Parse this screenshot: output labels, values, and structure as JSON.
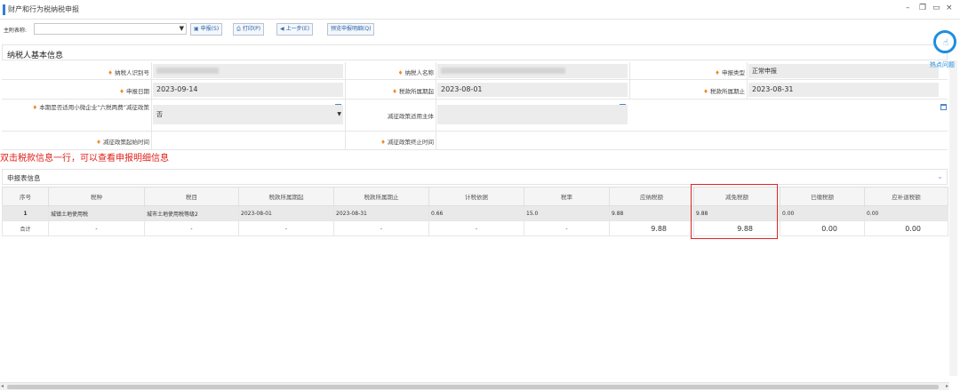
{
  "window": {
    "title": "财产和行为税纳税申报",
    "controls": {
      "minimize": "–",
      "restore": "❐",
      "maximize": "▭",
      "close": "×"
    }
  },
  "toolbar": {
    "main_table_label": "主附表称:",
    "main_table_value": "",
    "declare_label": "申报(S)",
    "print_label": "打印(P)",
    "prev_label": "上一步(E)",
    "preview_label": "预览申报明细(Q)"
  },
  "basic_info": {
    "section_title": "纳税人基本信息",
    "taxpayer_id_label": "纳税人识别号",
    "taxpayer_name_label": "纳税人名称",
    "declare_type_label": "申报类型",
    "declare_type_value": "正常申报",
    "declare_date_label": "申报日期",
    "declare_date_value": "2023-09-14",
    "period_start_label": "税款所属期起",
    "period_start_value": "2023-08-01",
    "period_end_label": "税款所属期止",
    "period_end_value": "2023-08-31",
    "small_biz_label": "本期是否适用小微企业“六税两费”减征政策",
    "small_biz_value": "否",
    "reduction_subject_label": "减征政策适用主体",
    "reduction_start_label": "减征政策起始时间",
    "reduction_end_label": "减征政策终止时间"
  },
  "hint_text": "双击税款信息一行，可以查看申报明细信息",
  "declare_table": {
    "section_title": "申报表信息",
    "columns": [
      "序号",
      "税种",
      "税目",
      "税款所属期起",
      "税款所属期止",
      "计税依据",
      "税率",
      "应纳税额",
      "减免税额",
      "已缴税额",
      "应补退税额"
    ],
    "rows": [
      [
        "1",
        "城镇土地使用税",
        "城市土地使用税等级2",
        "2023-08-01",
        "2023-08-31",
        "0.66",
        "15.0",
        "9.88",
        "9.88",
        "0.00",
        "0.00"
      ],
      [
        "合计",
        "-",
        "-",
        "-",
        "-",
        "-",
        "-",
        "9.88",
        "9.88",
        "0.00",
        "0.00"
      ]
    ]
  },
  "help_widget": {
    "label": "热点问题"
  },
  "colors": {
    "accent": "#2f7fd1",
    "required": "#f08a24",
    "hint": "#e0201a",
    "highlight_box": "#d9262a"
  }
}
